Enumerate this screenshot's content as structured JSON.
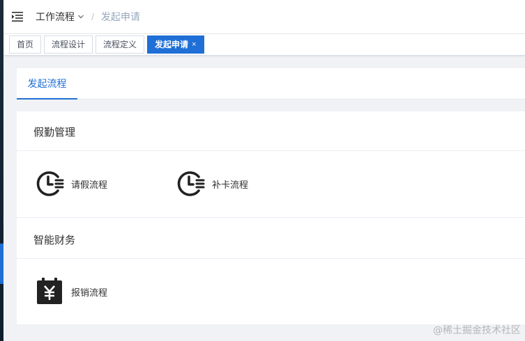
{
  "header": {
    "breadcrumb_parent": "工作流程",
    "breadcrumb_separator": "/",
    "breadcrumb_current": "发起申请"
  },
  "tags": [
    {
      "label": "首页",
      "active": false
    },
    {
      "label": "流程设计",
      "active": false
    },
    {
      "label": "流程定义",
      "active": false
    },
    {
      "label": "发起申请",
      "active": true
    }
  ],
  "tag_close_glyph": "×",
  "tabs": [
    {
      "label": "发起流程",
      "active": true
    }
  ],
  "groups": [
    {
      "title": "假勤管理",
      "items": [
        {
          "label": "请假流程",
          "icon": "clock-list-icon"
        },
        {
          "label": "补卡流程",
          "icon": "clock-list-icon"
        }
      ]
    },
    {
      "title": "智能财务",
      "items": [
        {
          "label": "报销流程",
          "icon": "yen-calendar-icon"
        }
      ]
    }
  ],
  "watermark": "@稀土掘金技术社区",
  "colors": {
    "primary": "#1f6fd6",
    "sidebar": "#1b2a3b",
    "icon": "#222222"
  }
}
